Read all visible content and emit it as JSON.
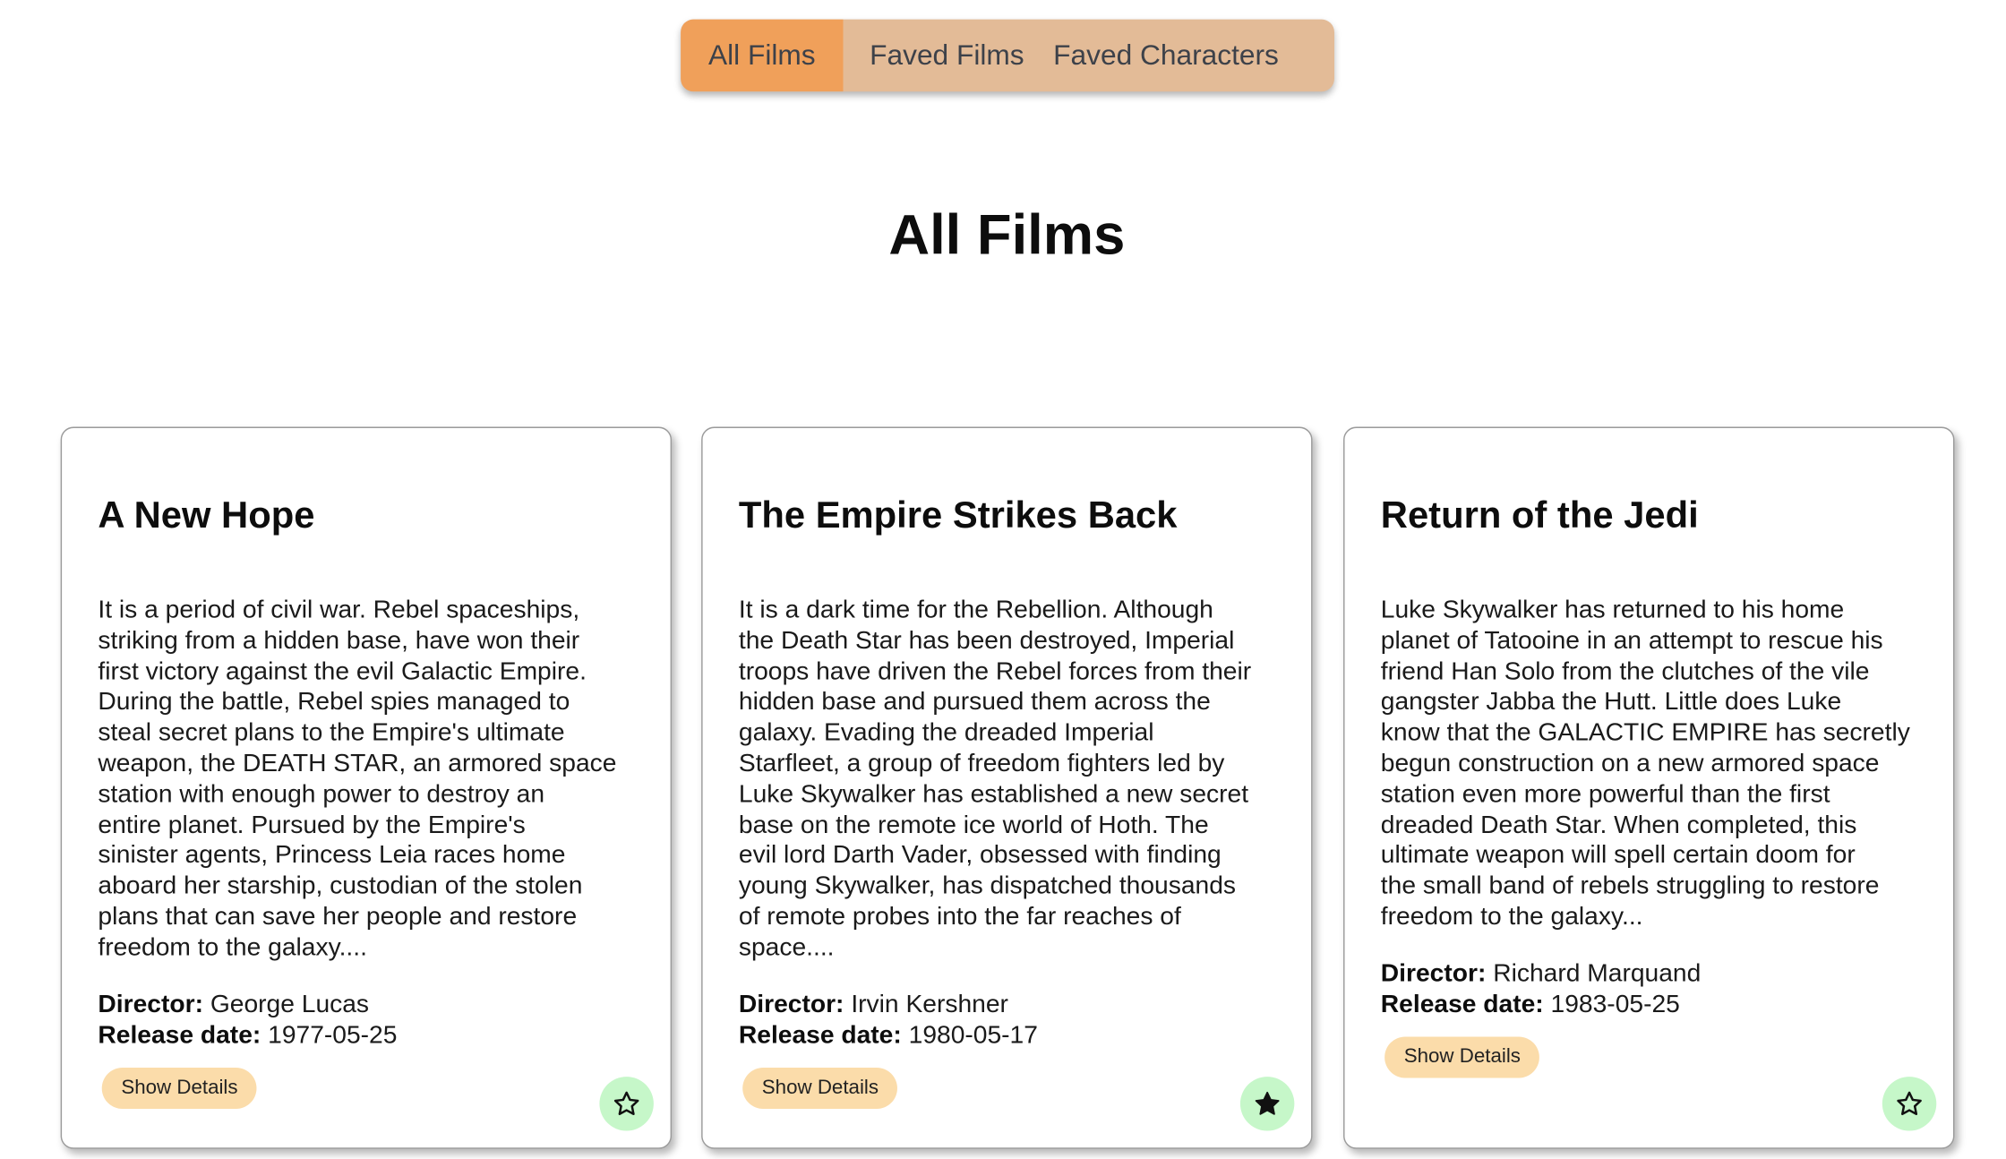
{
  "nav": {
    "tabs": [
      {
        "label": "All Films",
        "active": true
      },
      {
        "label": "Faved Films",
        "active": false
      },
      {
        "label": "Faved Characters",
        "active": false
      }
    ]
  },
  "page": {
    "title": "All Films"
  },
  "films": [
    {
      "title": "A New Hope",
      "opening_crawl": "It is a period of civil war. Rebel spaceships,\nstriking from a hidden base, have won their\nfirst victory against the evil Galactic Empire.\nDuring the battle, Rebel spies managed to\nsteal secret plans to the Empire's ultimate\nweapon, the DEATH STAR, an armored space\nstation with enough power to destroy an\nentire planet.  Pursued by the Empire's\nsinister agents, Princess Leia races home\naboard her starship, custodian of the stolen\nplans that can save her people and restore\nfreedom to the galaxy....",
      "director_label": "Director:",
      "director": "George Lucas",
      "release_label": "Release date:",
      "release_date": "1977-05-25",
      "details_label": "Show Details",
      "faved": false,
      "fav_icon": "star-outline-icon"
    },
    {
      "title": "The Empire Strikes Back",
      "opening_crawl": "It is a dark time for the Rebellion. Although\nthe Death Star has been destroyed, Imperial\ntroops have driven the Rebel forces from their\nhidden base and pursued them across the\ngalaxy.  Evading the dreaded Imperial\nStarfleet, a group of freedom fighters led by\nLuke Skywalker has established a new secret\nbase on the remote ice world of Hoth.  The\nevil lord Darth Vader, obsessed with finding\nyoung Skywalker, has dispatched thousands\nof remote probes into the far reaches of\nspace....",
      "director_label": "Director:",
      "director": "Irvin Kershner",
      "release_label": "Release date:",
      "release_date": "1980-05-17",
      "details_label": "Show Details",
      "faved": true,
      "fav_icon": "star-filled-icon"
    },
    {
      "title": "Return of the Jedi",
      "opening_crawl": "Luke Skywalker has returned to his home\nplanet of Tatooine in an attempt to rescue his\nfriend Han Solo from the clutches of the vile\ngangster Jabba the Hutt.  Little does Luke\nknow that the GALACTIC EMPIRE has secretly\nbegun construction on a new armored space\nstation even more powerful than the first\ndreaded Death Star.  When completed, this\nultimate weapon will spell certain doom for\nthe small band of rebels struggling to restore\nfreedom to the galaxy...",
      "director_label": "Director:",
      "director": "Richard Marquand",
      "release_label": "Release date:",
      "release_date": "1983-05-25",
      "details_label": "Show Details",
      "faved": false,
      "fav_icon": "star-outline-icon"
    }
  ],
  "colors": {
    "nav_bg": "#e3bb97",
    "nav_active": "#f0a05a",
    "details_button": "#fbdcaa",
    "fav_button": "#c6f7c9"
  }
}
